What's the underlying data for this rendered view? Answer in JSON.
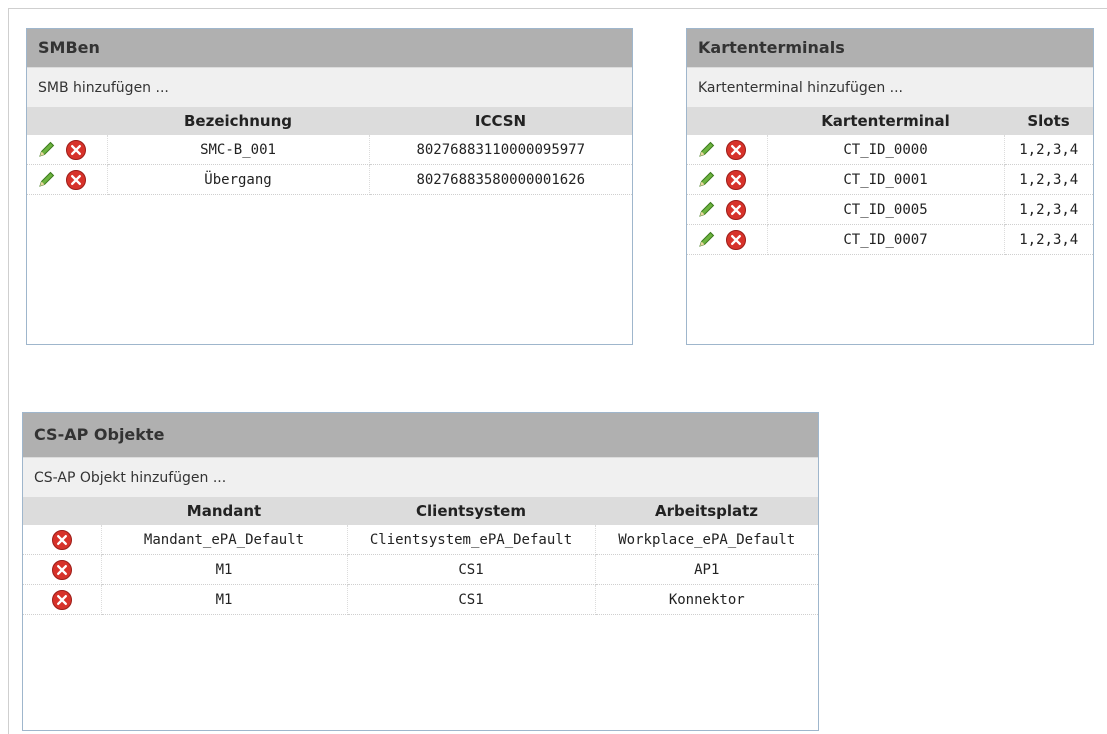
{
  "smb_panel": {
    "title": "SMBen",
    "add_label": "SMB hinzufügen ...",
    "columns": [
      "Bezeichnung",
      "ICCSN"
    ],
    "rows": [
      {
        "bezeichnung": "SMC-B_001",
        "iccsn": "80276883110000095977"
      },
      {
        "bezeichnung": "Übergang",
        "iccsn": "80276883580000001626"
      }
    ]
  },
  "ct_panel": {
    "title": "Kartenterminals",
    "add_label": "Kartenterminal hinzufügen ...",
    "columns": [
      "Kartenterminal",
      "Slots"
    ],
    "rows": [
      {
        "terminal": "CT_ID_0000",
        "slots": "1,2,3,4"
      },
      {
        "terminal": "CT_ID_0001",
        "slots": "1,2,3,4"
      },
      {
        "terminal": "CT_ID_0005",
        "slots": "1,2,3,4"
      },
      {
        "terminal": "CT_ID_0007",
        "slots": "1,2,3,4"
      }
    ]
  },
  "csap_panel": {
    "title": "CS-AP Objekte",
    "add_label": "CS-AP Objekt hinzufügen ...",
    "columns": [
      "Mandant",
      "Clientsystem",
      "Arbeitsplatz"
    ],
    "rows": [
      {
        "mandant": "Mandant_ePA_Default",
        "clientsystem": "Clientsystem_ePA_Default",
        "arbeitsplatz": "Workplace_ePA_Default"
      },
      {
        "mandant": "M1",
        "clientsystem": "CS1",
        "arbeitsplatz": "AP1"
      },
      {
        "mandant": "M1",
        "clientsystem": "CS1",
        "arbeitsplatz": "Konnektor"
      }
    ]
  },
  "icons": {
    "edit": "pencil-icon",
    "delete": "delete-icon"
  },
  "colors": {
    "header_bg": "#b0b0b0",
    "add_row_bg": "#f0f0f0",
    "table_header_bg": "#dcdcdc",
    "panel_border": "#9fb6cc",
    "edit_green": "#5aa02c",
    "delete_red": "#d7322a"
  }
}
